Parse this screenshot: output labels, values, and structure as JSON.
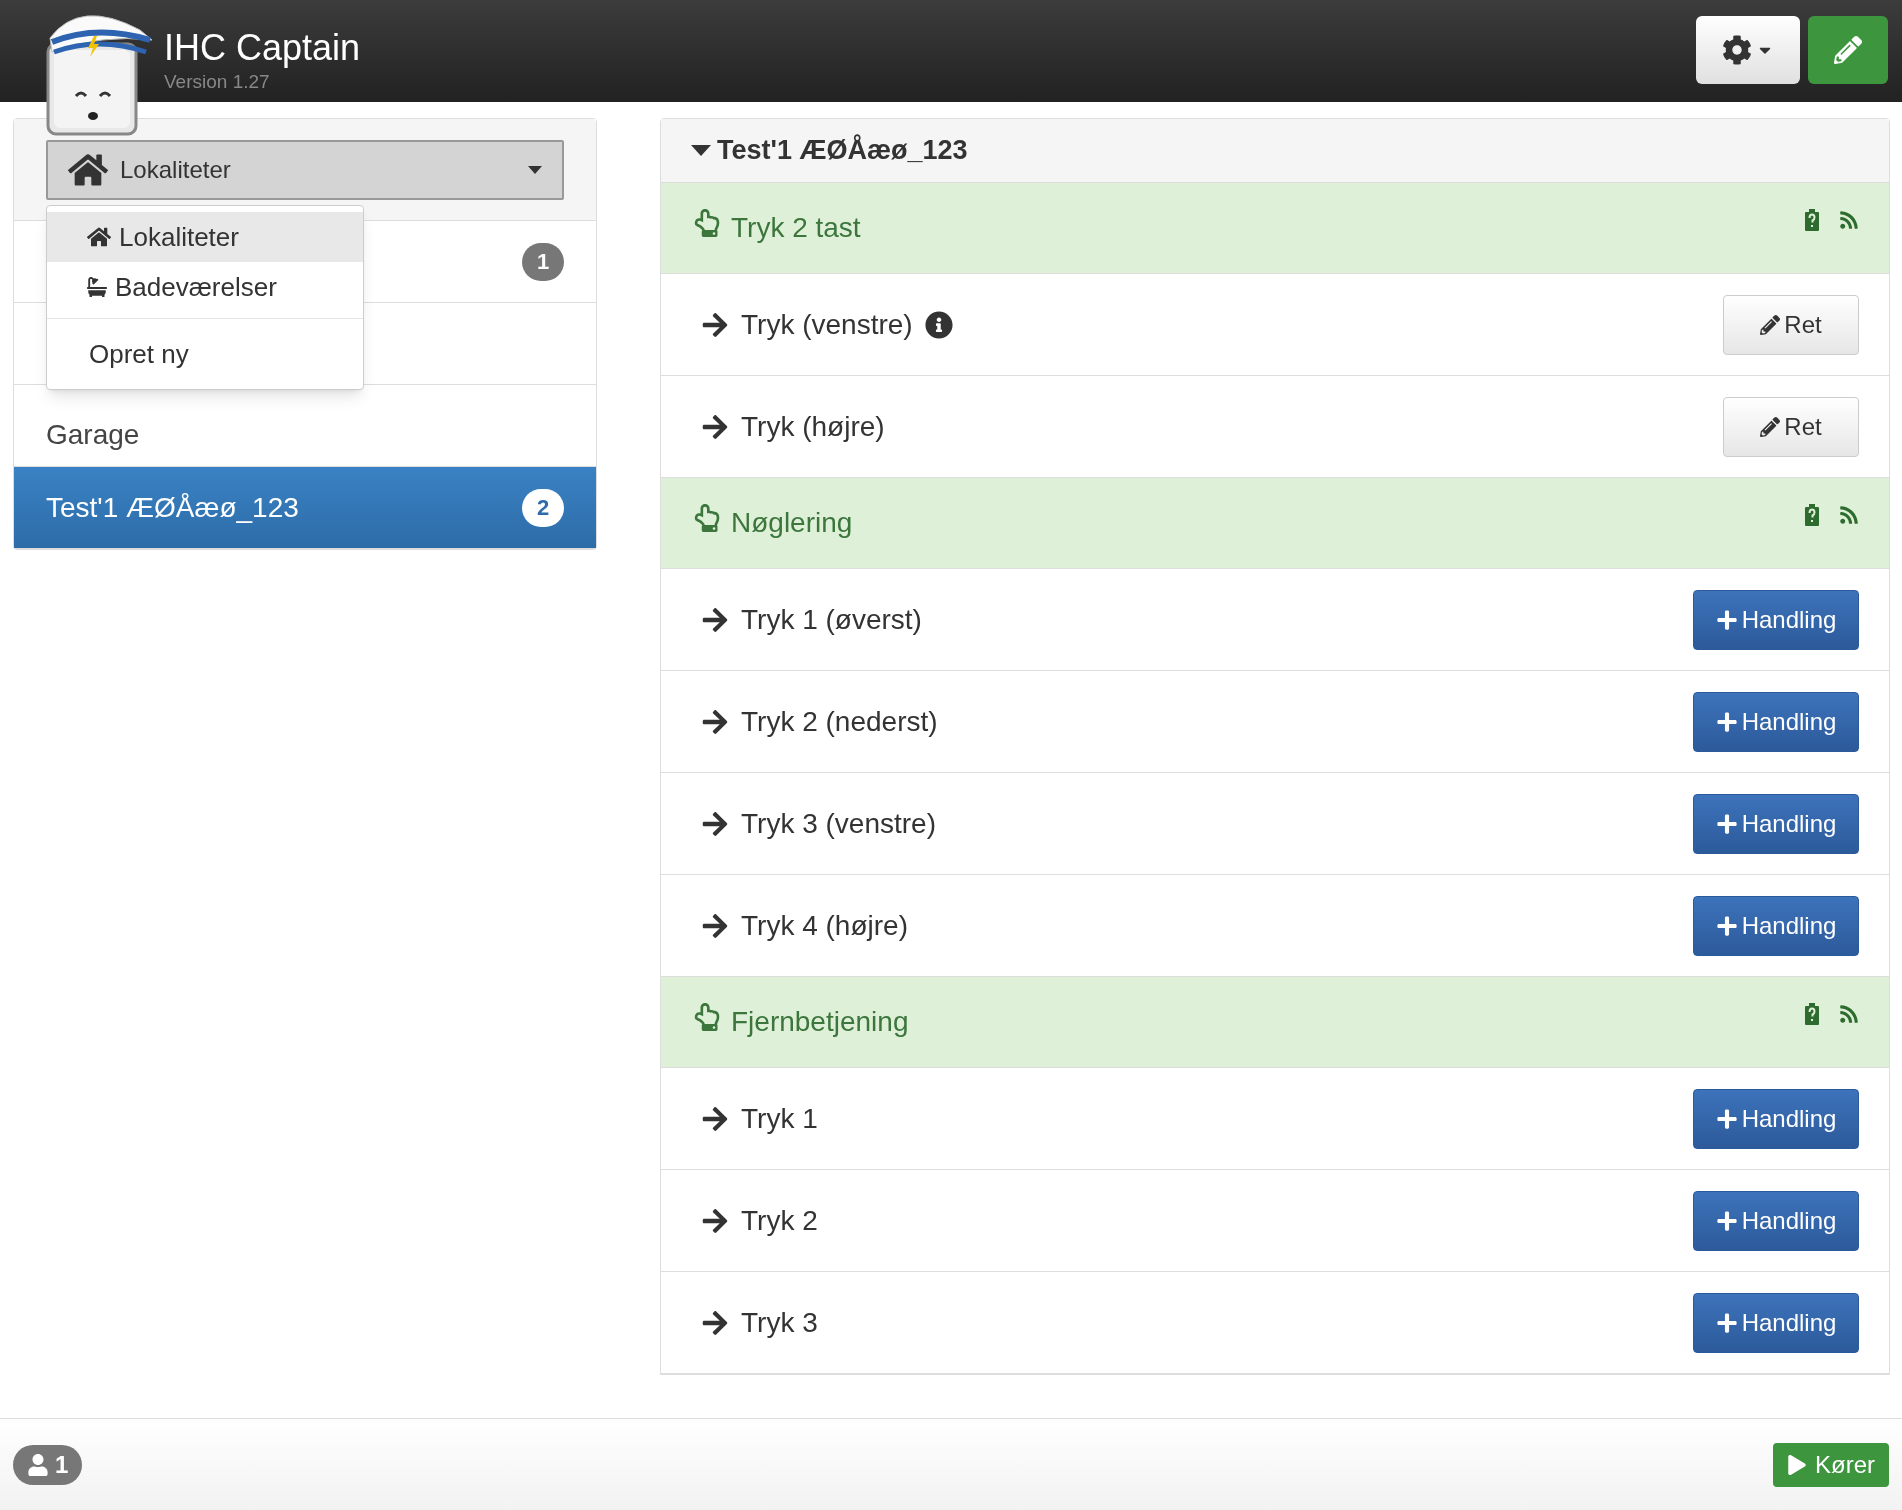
{
  "header": {
    "title": "IHC Captain",
    "version": "Version 1.27"
  },
  "location_select": {
    "label": "Lokaliteter",
    "menu": [
      {
        "kind": "home",
        "label": "Lokaliteter",
        "selected": true
      },
      {
        "kind": "bath",
        "label": "Badeværelser",
        "selected": false
      },
      {
        "kind": "divider"
      },
      {
        "kind": "action",
        "label": "Opret ny",
        "selected": false
      }
    ]
  },
  "sidebar": {
    "items": [
      {
        "badge": "1",
        "selected": false
      },
      {
        "selected": false
      },
      {
        "label": "Garage",
        "selected": false
      },
      {
        "label": "Test'1 ÆØÅæø_123",
        "badge": "2",
        "selected": true
      }
    ]
  },
  "panel": {
    "title": "Test'1 ÆØÅæø_123",
    "expanded": true,
    "groups": [
      {
        "name": "Tryk 2 tast",
        "items": [
          {
            "label": "Tryk (venstre)",
            "info": true,
            "kind": "edit",
            "button": "Ret"
          },
          {
            "label": "Tryk (højre)",
            "info": false,
            "kind": "edit",
            "button": "Ret"
          }
        ]
      },
      {
        "name": "Nøglering",
        "items": [
          {
            "label": "Tryk 1 (øverst)",
            "info": false,
            "kind": "add",
            "button": "Handling"
          },
          {
            "label": "Tryk 2 (nederst)",
            "info": false,
            "kind": "add",
            "button": "Handling"
          },
          {
            "label": "Tryk 3 (venstre)",
            "info": false,
            "kind": "add",
            "button": "Handling"
          },
          {
            "label": "Tryk 4 (højre)",
            "info": false,
            "kind": "add",
            "button": "Handling"
          }
        ]
      },
      {
        "name": "Fjernbetjening",
        "items": [
          {
            "label": "Tryk 1",
            "info": false,
            "kind": "add",
            "button": "Handling"
          },
          {
            "label": "Tryk 2",
            "info": false,
            "kind": "add",
            "button": "Handling"
          },
          {
            "label": "Tryk 3",
            "info": false,
            "kind": "add",
            "button": "Handling"
          }
        ]
      }
    ]
  },
  "footer": {
    "users": "1",
    "status": "Kører"
  }
}
